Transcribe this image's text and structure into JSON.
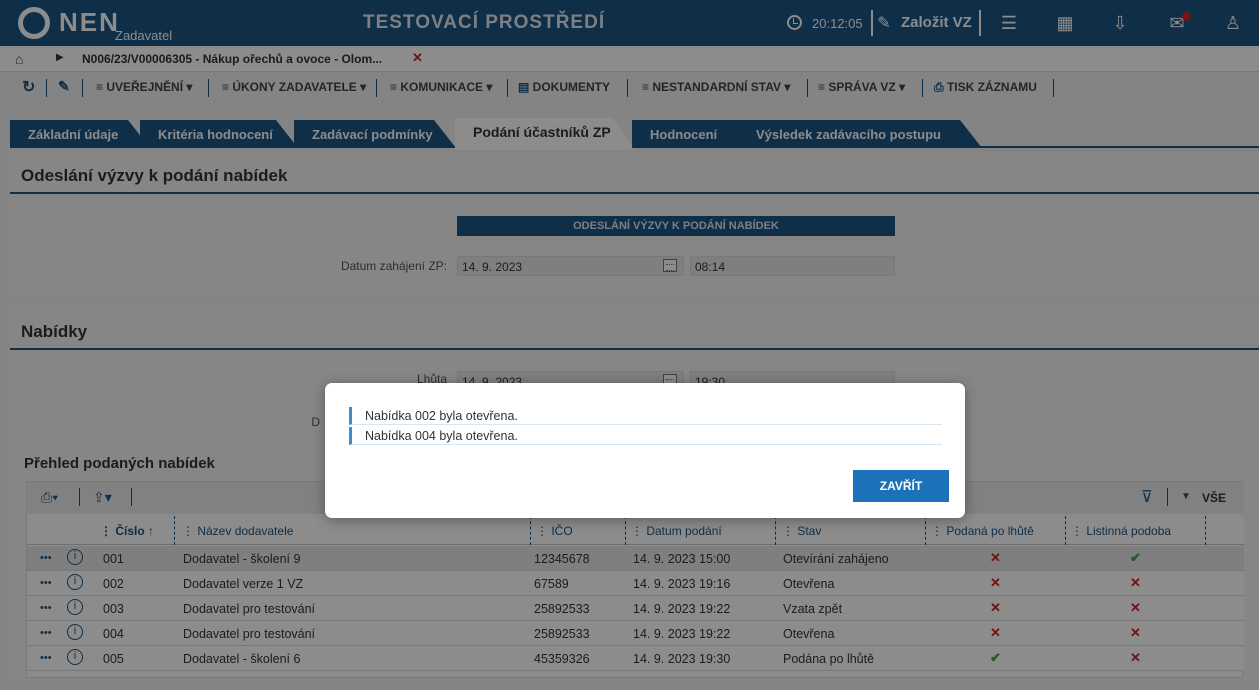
{
  "header": {
    "logo_text": "NEN",
    "logo_sub": "Zadavatel",
    "env_title": "TESTOVACÍ PROSTŘEDÍ",
    "time": "20:12:05",
    "create_label": "Založit VZ",
    "icons": [
      "clock-icon",
      "edit-icon",
      "menu-icon",
      "calculator-icon",
      "inbox-icon",
      "mail-icon",
      "user-icon"
    ]
  },
  "breadcrumb": {
    "item": "N006/23/V00006305 - Nákup ořechů a ovoce - Olom...",
    "close": "✕"
  },
  "toolbar": {
    "uverejneni": "UVEŘEJNĚNÍ",
    "ukony": "ÚKONY ZADAVATELE",
    "komunikace": "KOMUNIKACE",
    "dokumenty": "DOKUMENTY",
    "nestandardni": "NESTANDARDNÍ STAV",
    "sprava": "SPRÁVA VZ",
    "tisk": "TISK ZÁZNAMU"
  },
  "tabs": [
    "Základní údaje",
    "Kritéria hodnocení",
    "Zadávací podmínky",
    "Podání účastníků ZP",
    "Hodnocení",
    "Výsledek zadávacího postupu"
  ],
  "section1": {
    "title": "Odeslání výzvy k podání nabídek",
    "form_header": "ODESLÁNÍ VÝZVY K PODÁNÍ NABÍDEK",
    "date_label": "Datum zahájení ZP:",
    "date_value": "14. 9. 2023",
    "time_value": "08:14"
  },
  "section2": {
    "title": "Nabídky",
    "deadline_label": "Lhůta",
    "deadline_date": "14. 9. 2023",
    "deadline_time": "19:30",
    "second_label_fragment": "D"
  },
  "grid": {
    "title": "Přehled podaných nabídek",
    "filter_all": "VŠE",
    "columns": [
      "Číslo ↑",
      "Název dodavatele",
      "IČO",
      "Datum podání",
      "Stav",
      "Podaná po lhůtě",
      "Listinná podoba"
    ],
    "rows": [
      {
        "cislo": "001",
        "nazev": "Dodavatel - školení 9",
        "ico": "12345678",
        "datum": "14. 9. 2023 15:00",
        "stav": "Otevírání zahájeno",
        "po_lhute": "✕",
        "listinna": "✔"
      },
      {
        "cislo": "002",
        "nazev": "Dodavatel verze 1 VZ",
        "ico": "67589",
        "datum": "14. 9. 2023 19:16",
        "stav": "Otevřena",
        "po_lhute": "✕",
        "listinna": "✕"
      },
      {
        "cislo": "003",
        "nazev": "Dodavatel pro testování",
        "ico": "25892533",
        "datum": "14. 9. 2023 19:22",
        "stav": "Vzata zpět",
        "po_lhute": "✕",
        "listinna": "✕"
      },
      {
        "cislo": "004",
        "nazev": "Dodavatel pro testování",
        "ico": "25892533",
        "datum": "14. 9. 2023 19:22",
        "stav": "Otevřena",
        "po_lhute": "✕",
        "listinna": "✕"
      },
      {
        "cislo": "005",
        "nazev": "Dodavatel - školení 6",
        "ico": "45359326",
        "datum": "14. 9. 2023 19:30",
        "stav": "Podána po lhůtě",
        "po_lhute": "✔",
        "listinna": "✕"
      }
    ]
  },
  "dialog": {
    "messages": [
      "Nabídka 002 byla otevřena.",
      "Nabídka 004 byla otevřena."
    ],
    "close_label": "ZAVŘÍT"
  },
  "colors": {
    "primary": "#1c5584",
    "button": "#1c72b8",
    "red": "#d02020",
    "green": "#3aa53a"
  }
}
